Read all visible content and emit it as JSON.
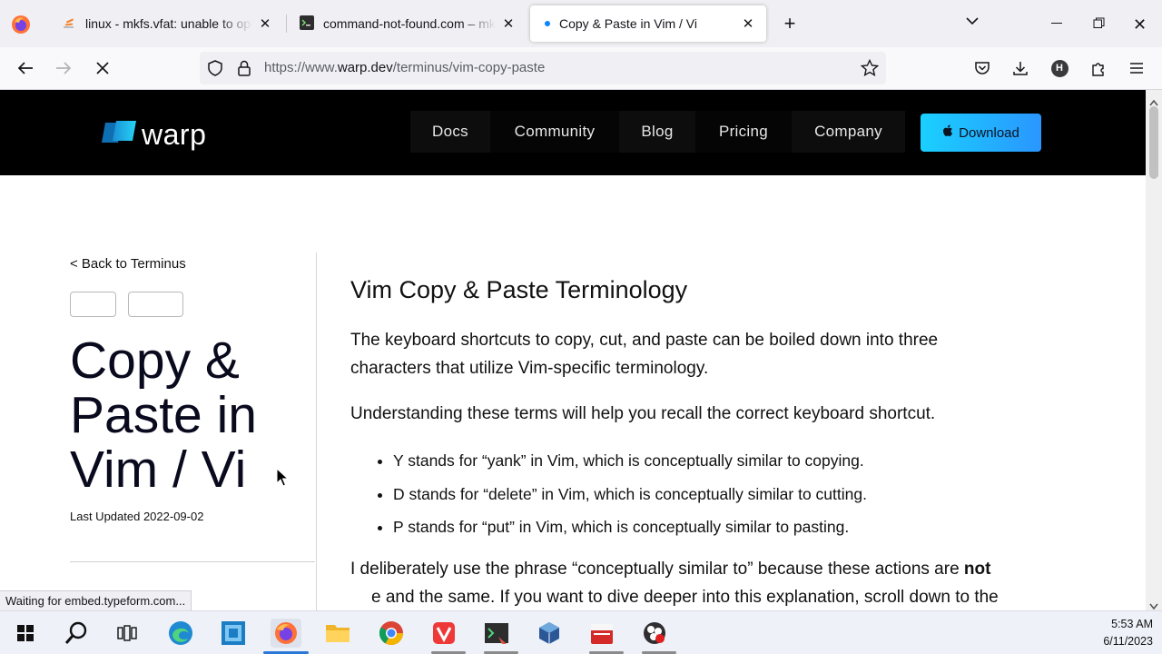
{
  "browser": {
    "tabs": [
      {
        "title": "linux - mkfs.vfat: unable to open",
        "icon": "stackoverflow-icon",
        "active": false
      },
      {
        "title": "command-not-found.com – mkfs",
        "icon": "terminal-favicon-icon",
        "active": false
      },
      {
        "title": "Copy & Paste in Vim / Vi",
        "icon": "loading-dot-icon",
        "active": true
      }
    ],
    "url_prefix": "https://www.",
    "url_domain": "warp.dev",
    "url_path": "/terminus/vim-copy-paste",
    "status_text": "Waiting for embed.typeform.com..."
  },
  "site": {
    "logo_text": "warp",
    "nav": [
      "Docs",
      "Community",
      "Blog",
      "Pricing",
      "Company"
    ],
    "download_label": "Download"
  },
  "article": {
    "back_link": "< Back to Terminus",
    "title": "Copy & Paste in Vim / Vi",
    "last_updated": "Last Updated 2022-09-02",
    "section_heading": "Vim Copy & Paste Terminology",
    "para1": "The keyboard shortcuts to copy, cut, and paste can be boiled down into three characters that utilize Vim-specific terminology.",
    "para2": "Understanding these terms will help you recall the correct keyboard shortcut.",
    "bullets": [
      "Y stands for “yank” in Vim, which is conceptually similar to copying.",
      "D stands for “delete” in Vim, which is conceptually similar to cutting.",
      "P stands for “put” in Vim, which is conceptually similar to pasting."
    ],
    "para3_start": "I deliberately use the phrase “conceptually similar to” because these actions are ",
    "para3_bold": "not",
    "para3_line2": "e and the same. If you want to dive deeper into this explanation, scroll down to the"
  },
  "taskbar": {
    "time": "5:53 AM",
    "date": "6/11/2023"
  },
  "colors": {
    "accent_start": "#1ad0ff",
    "accent_end": "#2a96ff",
    "header_bg": "#000000"
  }
}
